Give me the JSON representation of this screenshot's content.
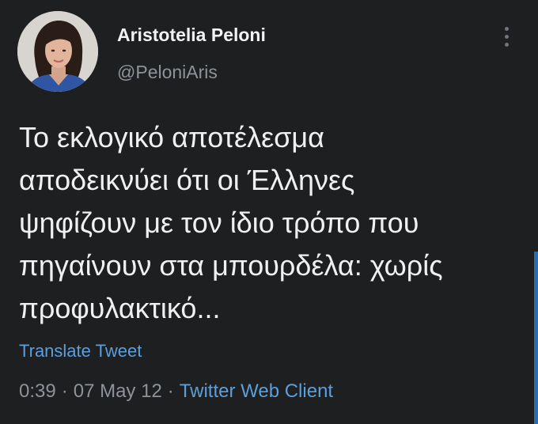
{
  "tweet": {
    "author": {
      "display_name": "Aristotelia Peloni",
      "handle": "@PeloniAris"
    },
    "text_lines": [
      "Το εκλογικό αποτέλεσμα",
      "αποδεικνύει ότι οι Έλληνες",
      "ψηφίζουν με τον ίδιο τρόπο που",
      "πηγαίνουν στα μπουρδέλα: χωρίς",
      "προφυλακτικό..."
    ],
    "translate_label": "Translate Tweet",
    "time": "0:39",
    "date": "07 May 12",
    "separator": "·",
    "client": "Twitter Web Client"
  },
  "icons": {
    "more": "more-vertical-icon",
    "avatar": "profile-photo"
  },
  "colors": {
    "background": "#1e1f21",
    "text": "#eef0f2",
    "muted": "#8d9399",
    "link": "#5b9fdc"
  }
}
